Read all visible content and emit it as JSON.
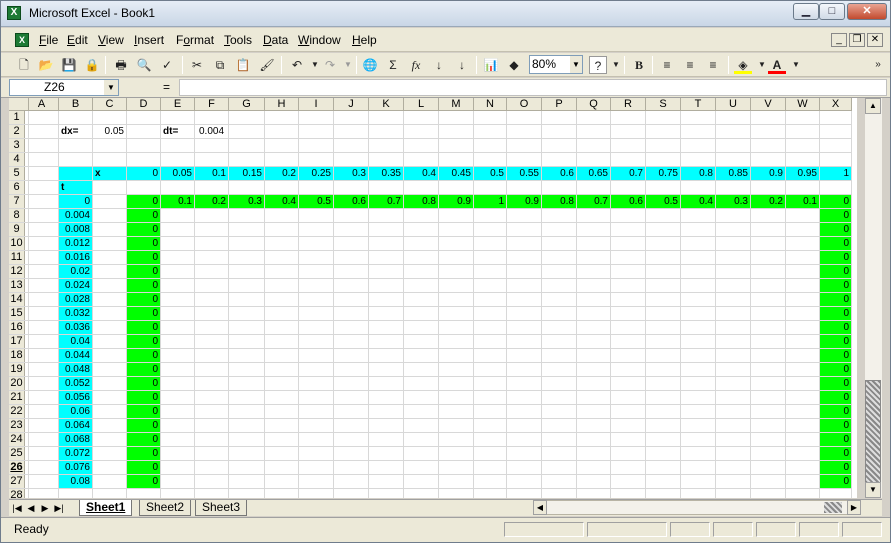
{
  "window": {
    "title": "Microsoft Excel - Book1",
    "app_icon": "X",
    "min": "▁",
    "max": "□",
    "close": "✕"
  },
  "menu": {
    "items": [
      {
        "label": "File",
        "u": "F",
        "rest": "ile"
      },
      {
        "label": "Edit",
        "u": "E",
        "rest": "dit"
      },
      {
        "label": "View",
        "u": "V",
        "rest": "iew"
      },
      {
        "label": "Insert",
        "u": "I",
        "rest": "nsert"
      },
      {
        "label": "Format",
        "u": "o",
        "pre": "F",
        "rest": "rmat"
      },
      {
        "label": "Tools",
        "u": "T",
        "rest": "ools"
      },
      {
        "label": "Data",
        "u": "D",
        "rest": "ata"
      },
      {
        "label": "Window",
        "u": "W",
        "rest": "indow"
      },
      {
        "label": "Help",
        "u": "H",
        "rest": "elp"
      }
    ],
    "doc_min": "_",
    "doc_restore": "❐",
    "doc_close": "✕"
  },
  "toolbar": {
    "zoom": "80%",
    "icons": [
      "new-icon",
      "open-icon",
      "save-icon",
      "permission-icon",
      "print-icon",
      "print-preview-icon",
      "spelling-icon",
      "cut-icon",
      "copy-icon",
      "paste-icon",
      "format-painter-icon",
      "undo-icon",
      "redo-icon",
      "hyperlink-icon",
      "autosum-icon",
      "function-icon",
      "sort-ascending-icon",
      "sort-descending-icon",
      "chart-wizard-icon",
      "drawing-icon",
      "help-icon",
      "bold-icon",
      "align-left-icon",
      "align-center-icon",
      "align-right-icon",
      "fill-color-icon",
      "font-color-icon"
    ],
    "glyphs": {
      "bold": "B",
      "sum": "Σ",
      "fx": "fx",
      "help": "?",
      "font": "A"
    }
  },
  "formula_bar": {
    "name_box": "Z26",
    "equals": "=",
    "content": ""
  },
  "sheet": {
    "columns": [
      "A",
      "B",
      "C",
      "D",
      "E",
      "F",
      "G",
      "H",
      "I",
      "J",
      "K",
      "L",
      "M",
      "N",
      "O",
      "P",
      "Q",
      "R",
      "S",
      "T",
      "U",
      "V",
      "W",
      "X"
    ],
    "rows": [
      "1",
      "2",
      "3",
      "4",
      "5",
      "6",
      "7",
      "8",
      "9",
      "10",
      "11",
      "12",
      "13",
      "14",
      "15",
      "16",
      "17",
      "18",
      "19",
      "20",
      "21",
      "22",
      "23",
      "24",
      "25",
      "26",
      "27",
      "28"
    ],
    "active_row": "26",
    "labels": {
      "dx_label": "dx=",
      "dx_value": "0.05",
      "dt_label": "dt=",
      "dt_value": "0.004",
      "x_label": "x",
      "t_label": "t"
    },
    "x_values": [
      "0",
      "0.05",
      "0.1",
      "0.15",
      "0.2",
      "0.25",
      "0.3",
      "0.35",
      "0.4",
      "0.45",
      "0.5",
      "0.55",
      "0.6",
      "0.65",
      "0.7",
      "0.75",
      "0.8",
      "0.85",
      "0.9",
      "0.95",
      "1"
    ],
    "initial_row": [
      "0",
      "0.1",
      "0.2",
      "0.3",
      "0.4",
      "0.5",
      "0.6",
      "0.7",
      "0.8",
      "0.9",
      "1",
      "0.9",
      "0.8",
      "0.7",
      "0.6",
      "0.5",
      "0.4",
      "0.3",
      "0.2",
      "0.1",
      "0"
    ],
    "t_values": [
      "0",
      "0.004",
      "0.008",
      "0.012",
      "0.016",
      "0.02",
      "0.024",
      "0.028",
      "0.032",
      "0.036",
      "0.04",
      "0.044",
      "0.048",
      "0.052",
      "0.056",
      "0.06",
      "0.064",
      "0.068",
      "0.072",
      "0.076",
      "0.08"
    ],
    "boundary_value": "0",
    "colors": {
      "cyan": "#00ffff",
      "green": "#00ff00"
    }
  },
  "tabs": [
    "Sheet1",
    "Sheet2",
    "Sheet3"
  ],
  "status": {
    "text": "Ready"
  }
}
